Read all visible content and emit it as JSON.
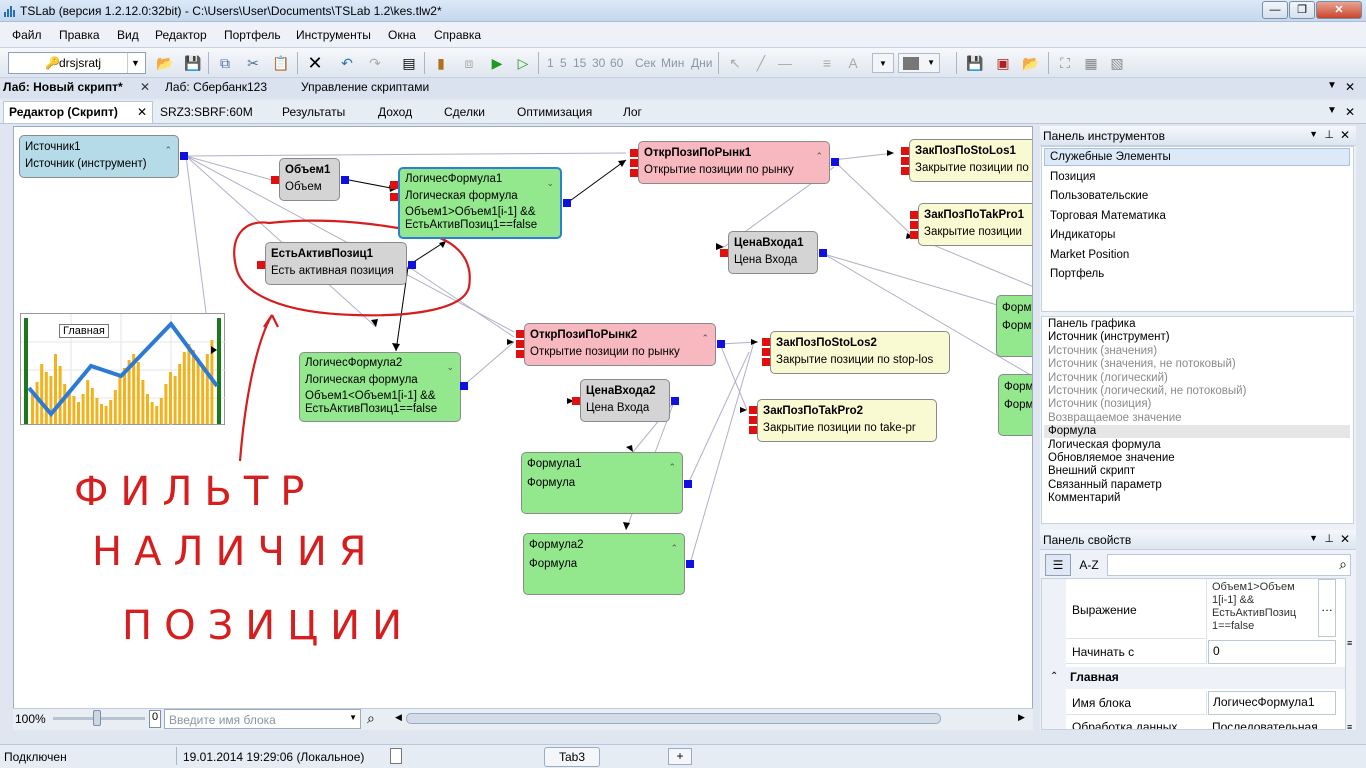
{
  "window": {
    "title": "TSLab (версия 1.2.12.0:32bit) - C:\\Users\\User\\Documents\\TSLab 1.2\\kes.tlw2*"
  },
  "menu": [
    "Файл",
    "Правка",
    "Вид",
    "Редактор",
    "Портфель",
    "Инструменты",
    "Окна",
    "Справка"
  ],
  "toolbar": {
    "user": "drsjsratj",
    "intervals": [
      "1",
      "5",
      "15",
      "30",
      "60"
    ],
    "units": [
      "Сек",
      "Мин",
      "Дни"
    ]
  },
  "doc_tabs": [
    {
      "label": "Лаб: Новый скрипт*",
      "active": true
    },
    {
      "label": "Лаб: Сбербанк123",
      "active": false
    },
    {
      "label": "Управление скриптами",
      "active": false
    }
  ],
  "editor_tabs": [
    {
      "label": "Редактор (Скрипт)",
      "active": true
    },
    {
      "label": "SRZ3:SBRF:60M"
    },
    {
      "label": "Результаты"
    },
    {
      "label": "Доход"
    },
    {
      "label": "Сделки"
    },
    {
      "label": "Оптимизация"
    },
    {
      "label": "Лог"
    }
  ],
  "nodes": {
    "src": {
      "title": "Источник1",
      "sub": "Источник (инструмент)"
    },
    "vol": {
      "title": "Объем1",
      "sub": "Объем"
    },
    "logic1": {
      "title": "ЛогичесФормула1",
      "sub": "Логическая формула",
      "expr1": "Объем1>Объем1[i-1] &&",
      "expr2": "ЕстьАктивПозиц1==false"
    },
    "open1": {
      "title": "ОткрПозиПоРынк1",
      "sub": "Открытие позиции по рынку"
    },
    "stop1": {
      "title": "ЗакПозПоStoLos1",
      "sub": "Закрытие позиции по"
    },
    "take1": {
      "title": "ЗакПозПоTakPro1",
      "sub": "Закрытие позиции"
    },
    "price1": {
      "title": "ЦенаВхода1",
      "sub": "Цена Входа"
    },
    "haspos": {
      "title": "ЕстьАктивПозиц1",
      "sub": "Есть активная позиция"
    },
    "logic2": {
      "title": "ЛогичесФормула2",
      "sub": "Логическая формула",
      "expr1": "Объем1<Объем1[i-1] &&",
      "expr2": "ЕстьАктивПозиц1==false"
    },
    "open2": {
      "title": "ОткрПозиПоРынк2",
      "sub": "Открытие позиции по рынку"
    },
    "stop2": {
      "title": "ЗакПозПоStoLos2",
      "sub": "Закрытие позиции по stop-los"
    },
    "price2": {
      "title": "ЦенаВхода2",
      "sub": "Цена Входа"
    },
    "take2": {
      "title": "ЗакПозПоTakPro2",
      "sub": "Закрытие позиции по take-pr"
    },
    "f1": {
      "title": "Формула1",
      "sub": "Формула"
    },
    "f2": {
      "title": "Формула2",
      "sub": "Формула"
    },
    "fa": {
      "title": "Форму",
      "sub": "Форму"
    },
    "fb": {
      "title": "Форм",
      "sub": "Форм"
    },
    "chart": {
      "title": "Главная"
    }
  },
  "annotation": [
    "ФИЛЬТР",
    "НАЛИЧИЯ",
    "ПОЗИЦИИ"
  ],
  "canvas_bottom": {
    "zoom": "100%",
    "counter": "0",
    "search_placeholder": "Введите имя блока"
  },
  "tool_panel": {
    "title": "Панель инструментов",
    "categories": [
      "Служебные Элементы",
      "Позиция",
      "Пользовательские",
      "Торговая Математика",
      "Индикаторы",
      "Market Position",
      "Портфель"
    ],
    "items": [
      {
        "label": "Панель графика",
        "enabled": true
      },
      {
        "label": "Источник (инструмент)",
        "enabled": true
      },
      {
        "label": "Источник (значения)",
        "enabled": false
      },
      {
        "label": "Источник (значения, не потоковый)",
        "enabled": false
      },
      {
        "label": "Источник (логический)",
        "enabled": false
      },
      {
        "label": "Источник (логический, не потоковый)",
        "enabled": false
      },
      {
        "label": "Источник (позиция)",
        "enabled": false
      },
      {
        "label": "Возвращаемое значение",
        "enabled": false
      },
      {
        "label": "Формула",
        "enabled": true
      },
      {
        "label": "Логическая формула",
        "enabled": true
      },
      {
        "label": "Обновляемое значение",
        "enabled": true
      },
      {
        "label": "Внешний скрипт",
        "enabled": true
      },
      {
        "label": "Связанный параметр",
        "enabled": true
      },
      {
        "label": "Комментарий",
        "enabled": true
      }
    ]
  },
  "props_panel": {
    "title": "Панель свойств",
    "sort_label": "A-Z",
    "expr_label": "Выражение",
    "expr_lines": [
      "Объем1>Объем",
      "1[i-1] &&",
      "ЕстьАктивПозиц",
      "1==false"
    ],
    "start_label": "Начинать с",
    "start_value": "0",
    "section": "Главная",
    "name_label": "Имя блока",
    "name_value": "ЛогичесФормула1",
    "proc_label": "Обработка данных",
    "proc_value": "Последовательная"
  },
  "status": {
    "state": "Подключен",
    "datetime": "19.01.2014 19:29:06 (Локальное)",
    "tab": "Tab3",
    "add": "+"
  }
}
